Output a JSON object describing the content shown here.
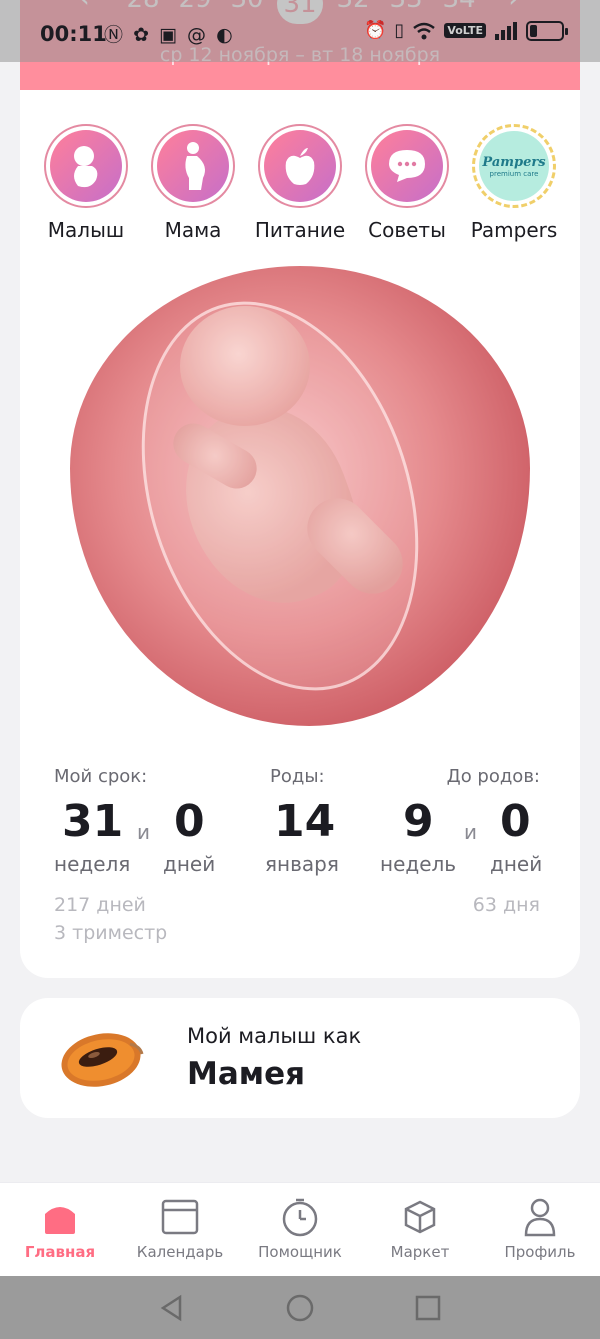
{
  "status_bar": {
    "time": "00:11",
    "left_icons": [
      "nfc-icon",
      "app-icon",
      "wb-icon",
      "at-icon",
      "app-icon"
    ],
    "right_icons": [
      "alarm-icon",
      "vibrate-icon",
      "wifi-icon",
      "volte-icon",
      "signal-icon",
      "battery-icon"
    ],
    "volte_label": "VoLTE"
  },
  "week_selector": {
    "weeks": [
      "28",
      "29",
      "30",
      "31",
      "32",
      "33",
      "34"
    ],
    "active_week": "31",
    "date_range": "ср 12 ноября – вт 18 ноября"
  },
  "categories": [
    {
      "label": "Малыш",
      "icon": "baby-icon"
    },
    {
      "label": "Мама",
      "icon": "pregnant-icon"
    },
    {
      "label": "Питание",
      "icon": "apple-icon"
    },
    {
      "label": "Советы",
      "icon": "chat-icon"
    },
    {
      "label": "Pampers",
      "icon": "pampers-logo",
      "logo_text": "Pampers",
      "logo_sub": "premium care"
    }
  ],
  "stats": {
    "term": {
      "heading": "Мой срок:",
      "weeks": "31",
      "and": "и",
      "days": "0",
      "weeks_unit": "неделя",
      "days_unit": "дней",
      "total_days": "217 дней",
      "trimester": "3 триместр"
    },
    "due": {
      "heading": "Роды:",
      "day": "14",
      "month": "января"
    },
    "until": {
      "heading": "До родов:",
      "weeks": "9",
      "and": "и",
      "days": "0",
      "weeks_unit": "недель",
      "days_unit": "дней",
      "total_days": "63 дня"
    }
  },
  "baby_like": {
    "label": "Мой малыш как",
    "fruit": "Мамея"
  },
  "bottom_nav": [
    {
      "label": "Главная",
      "icon": "home-icon",
      "active": true
    },
    {
      "label": "Календарь",
      "icon": "calendar-icon",
      "active": false
    },
    {
      "label": "Помощник",
      "icon": "timer-icon",
      "active": false
    },
    {
      "label": "Маркет",
      "icon": "box-icon",
      "active": false
    },
    {
      "label": "Профиль",
      "icon": "profile-icon",
      "active": false
    }
  ],
  "colors": {
    "accent": "#ff8e9d",
    "active_nav": "#ff6d83"
  }
}
